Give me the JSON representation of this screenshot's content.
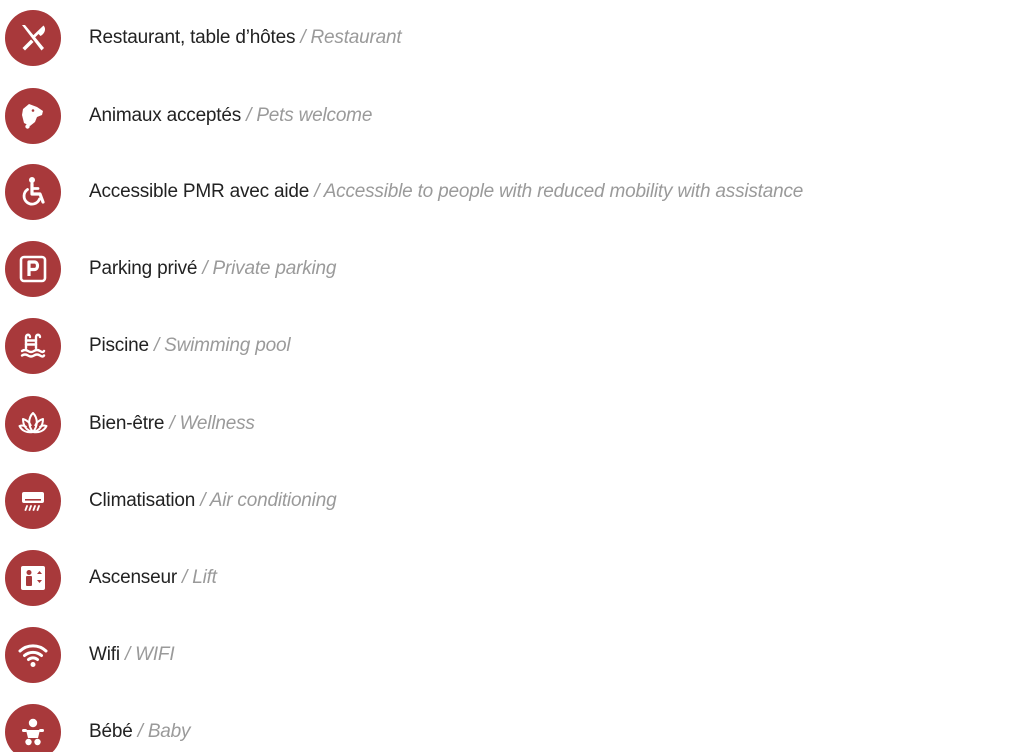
{
  "accent_color": "#a8393b",
  "separator": " / ",
  "amenities": [
    {
      "icon": "cutlery-icon",
      "fr": "Restaurant, table d’hôtes",
      "en": "Restaurant"
    },
    {
      "icon": "dog-icon",
      "fr": "Animaux acceptés",
      "en": "Pets welcome"
    },
    {
      "icon": "wheelchair-icon",
      "fr": "Accessible PMR avec aide",
      "en": "Accessible to people with reduced mobility with assistance"
    },
    {
      "icon": "parking-icon",
      "fr": "Parking privé",
      "en": "Private parking"
    },
    {
      "icon": "pool-icon",
      "fr": "Piscine",
      "en": "Swimming pool"
    },
    {
      "icon": "lotus-icon",
      "fr": "Bien-être",
      "en": "Wellness"
    },
    {
      "icon": "air-conditioner-icon",
      "fr": "Climatisation",
      "en": "Air conditioning"
    },
    {
      "icon": "elevator-icon",
      "fr": "Ascenseur",
      "en": "Lift"
    },
    {
      "icon": "wifi-icon",
      "fr": "Wifi",
      "en": "WIFI"
    },
    {
      "icon": "baby-icon",
      "fr": "Bébé",
      "en": "Baby"
    }
  ]
}
